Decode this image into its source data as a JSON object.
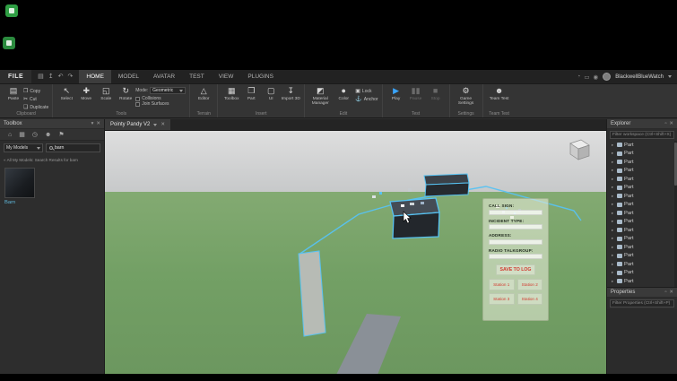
{
  "icons": {
    "close": "✕",
    "popout": "▫",
    "pin": "▾",
    "caret_down": "▾",
    "arrow_right": "▸",
    "paste": "▤",
    "copy": "❐",
    "cut": "✂",
    "duplicate": "❏",
    "editor": "△",
    "material": "◩",
    "color": "●",
    "lock": "▣",
    "anchor": "⚓",
    "game_settings": "⚙",
    "team_test": "☻",
    "toolbox_home": "⌂",
    "toolbox_inventory": "▦",
    "toolbox_recent": "◷",
    "toolbox_creations": "☻",
    "toolbox_plugins": "⚑"
  },
  "menu": {
    "file": "FILE",
    "quick": [
      {
        "name": "save-icon",
        "glyph": "▤"
      },
      {
        "name": "publish-icon",
        "glyph": "↥"
      },
      {
        "name": "undo-icon",
        "glyph": "↶"
      },
      {
        "name": "redo-icon",
        "glyph": "↷"
      }
    ],
    "tabs": [
      {
        "name": "tab-home",
        "label": "HOME",
        "active": true
      },
      {
        "name": "tab-model",
        "label": "MODEL"
      },
      {
        "name": "tab-avatar",
        "label": "AVATAR"
      },
      {
        "name": "tab-test",
        "label": "TEST"
      },
      {
        "name": "tab-view",
        "label": "VIEW"
      },
      {
        "name": "tab-plugins",
        "label": "PLUGINS"
      }
    ],
    "right_icons": [
      {
        "name": "notifications-icon",
        "glyph": "◔"
      },
      {
        "name": "chat-icon",
        "glyph": "▭"
      },
      {
        "name": "currency-icon",
        "glyph": "◉"
      }
    ],
    "account": "BlackwellBlueWatch"
  },
  "ribbon": {
    "clipboard": {
      "label": "Clipboard",
      "paste": "Paste",
      "small": [
        {
          "name": "copy-button",
          "label": "Copy",
          "glyph": "❐"
        },
        {
          "name": "cut-button",
          "label": "Cut",
          "glyph": "✂"
        },
        {
          "name": "duplicate-button",
          "label": "Duplicate",
          "glyph": "❏"
        }
      ]
    },
    "tools": {
      "label": "Tools",
      "items": [
        {
          "name": "select-tool-button",
          "label": "Select",
          "glyph": "↖"
        },
        {
          "name": "move-tool-button",
          "label": "Move",
          "glyph": "✚"
        },
        {
          "name": "scale-tool-button",
          "label": "Scale",
          "glyph": "◱"
        },
        {
          "name": "rotate-tool-button",
          "label": "Rotate",
          "glyph": "↻"
        }
      ],
      "mode_label": "Mode:",
      "mode_value": "Geometric",
      "checks": [
        {
          "name": "collisions-checkbox",
          "label": "Collisions"
        },
        {
          "name": "join-surfaces-checkbox",
          "label": "Join Surfaces"
        }
      ]
    },
    "terrain": {
      "label": "Terrain",
      "button": "Editor"
    },
    "insert": {
      "label": "Insert",
      "items": [
        {
          "name": "toolbox-button",
          "label": "Toolbox",
          "glyph": "▦"
        },
        {
          "name": "part-button",
          "label": "Part",
          "glyph": "❒"
        },
        {
          "name": "ui-button",
          "label": "UI",
          "glyph": "▢"
        },
        {
          "name": "import-3d-button",
          "label": "Import 3D",
          "glyph": "↧"
        }
      ]
    },
    "edit": {
      "label": "Edit",
      "items": [
        {
          "name": "material-manager-button",
          "label": "Material Manager",
          "glyph": "◩"
        },
        {
          "name": "color-button",
          "label": "Color",
          "glyph": "●"
        }
      ],
      "small": [
        {
          "name": "lock-button",
          "label": "Lock",
          "glyph": "▣"
        },
        {
          "name": "anchor-button",
          "label": "Anchor",
          "glyph": "⚓"
        }
      ]
    },
    "test": {
      "label": "Test",
      "items": [
        {
          "name": "play-button",
          "label": "Play",
          "glyph": "▶",
          "accent": true
        },
        {
          "name": "pause-button",
          "label": "Pause",
          "glyph": "▮▮",
          "disabled": true
        },
        {
          "name": "stop-button",
          "label": "Stop",
          "glyph": "■",
          "disabled": true
        }
      ]
    },
    "settings": {
      "label": "Settings",
      "button": "Game Settings"
    },
    "team": {
      "label": "Team Test",
      "button": "Team Test"
    }
  },
  "toolbox": {
    "title": "Toolbox",
    "tabs_icons": [
      {
        "name": "marketplace-icon",
        "glyph": "⌂"
      },
      {
        "name": "inventory-icon",
        "glyph": "▦"
      },
      {
        "name": "recent-icon",
        "glyph": "◷"
      },
      {
        "name": "creations-icon",
        "glyph": "☻"
      },
      {
        "name": "plugins-icon",
        "glyph": "⚑"
      }
    ],
    "category": "My Models",
    "search_value": "barn",
    "note": "« All My Models: Search Results for barn",
    "item_label": "Barn"
  },
  "viewport": {
    "tab": "Pointy Pandy V2",
    "overlay": {
      "fields": [
        {
          "name": "call-sign-field",
          "label": "CALL SIGN:"
        },
        {
          "name": "incident-type-field",
          "label": "INCIDENT TYPE:"
        },
        {
          "name": "address-field",
          "label": "ADDRESS:"
        },
        {
          "name": "radio-talkgroup-field",
          "label": "RADIO TALKGROUP:"
        }
      ],
      "save": "SAVE TO LOG",
      "stations": [
        {
          "name": "station-1-button",
          "label": "Station 1"
        },
        {
          "name": "station-2-button",
          "label": "Station 2"
        },
        {
          "name": "station-3-button",
          "label": "Station 3"
        },
        {
          "name": "station-4-button",
          "label": "Station 4"
        }
      ]
    }
  },
  "explorer": {
    "title": "Explorer",
    "filter": "Filter workspace (Ctrl+Shift+X)",
    "items": [
      {
        "label": "Part"
      },
      {
        "label": "Part"
      },
      {
        "label": "Part"
      },
      {
        "label": "Part"
      },
      {
        "label": "Part"
      },
      {
        "label": "Part"
      },
      {
        "label": "Part"
      },
      {
        "label": "Part"
      },
      {
        "label": "Part"
      },
      {
        "label": "Part"
      },
      {
        "label": "Part"
      },
      {
        "label": "Part"
      },
      {
        "label": "Part"
      },
      {
        "label": "Part"
      },
      {
        "label": "Part"
      },
      {
        "label": "Part"
      },
      {
        "label": "Part"
      }
    ]
  },
  "properties": {
    "title": "Properties",
    "filter": "Filter Properties (Ctrl+Shift+P)"
  },
  "colors": {
    "selection": "#57c2f2",
    "play_accent": "#3aa5ff",
    "overlay_red": "#d23b30"
  }
}
